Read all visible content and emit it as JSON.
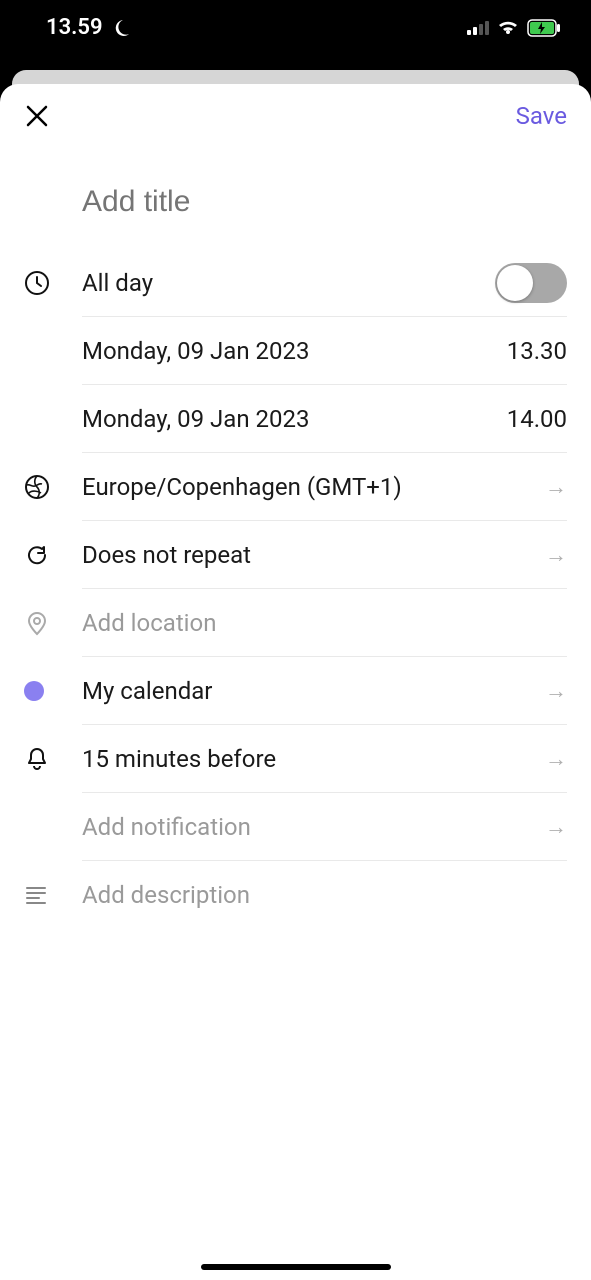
{
  "status": {
    "time": "13.59"
  },
  "header": {
    "save": "Save"
  },
  "title": {
    "placeholder": "Add title"
  },
  "allday": {
    "label": "All day"
  },
  "start": {
    "date": "Monday, 09 Jan 2023",
    "time": "13.30"
  },
  "end": {
    "date": "Monday, 09 Jan 2023",
    "time": "14.00"
  },
  "timezone": {
    "label": "Europe/Copenhagen (GMT+1)"
  },
  "repeat": {
    "label": "Does not repeat"
  },
  "location": {
    "placeholder": "Add location"
  },
  "calendar": {
    "label": "My calendar",
    "color": "#8a80f0"
  },
  "notification": {
    "label": "15 minutes before"
  },
  "add_notification": {
    "label": "Add notification"
  },
  "description": {
    "placeholder": "Add description"
  }
}
